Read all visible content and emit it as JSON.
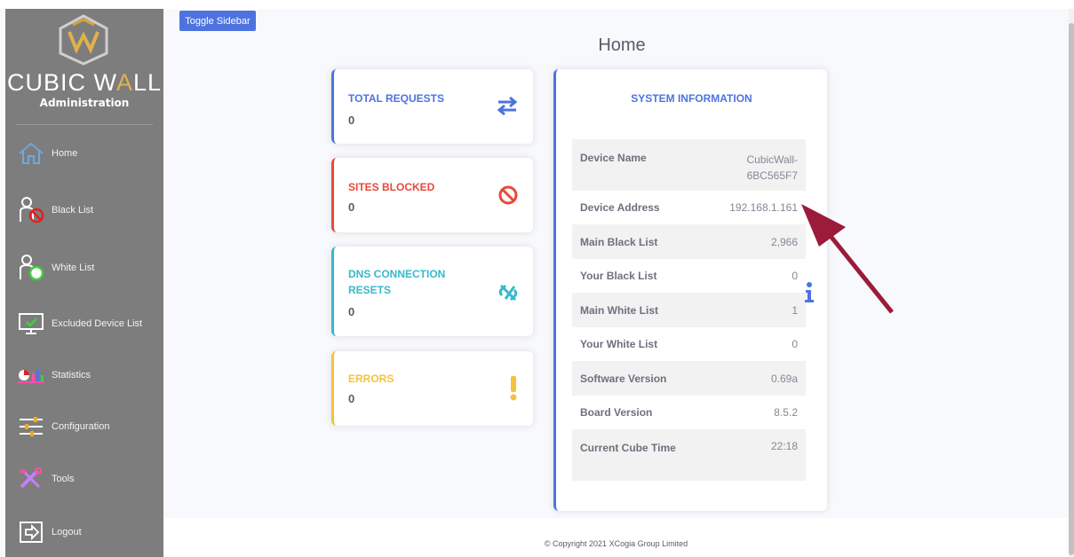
{
  "sidebar": {
    "brand_main": "CUBIC W",
    "brand_accent": "A",
    "brand_tail": "LL",
    "subtitle": "Administration",
    "items": [
      {
        "label": "Home",
        "icon": "home-icon"
      },
      {
        "label": "Black List",
        "icon": "black-list-icon"
      },
      {
        "label": "White List",
        "icon": "white-list-icon"
      },
      {
        "label": "Excluded Device List",
        "icon": "monitor-check-icon"
      },
      {
        "label": "Statistics",
        "icon": "statistics-icon"
      },
      {
        "label": "Configuration",
        "icon": "sliders-icon"
      },
      {
        "label": "Tools",
        "icon": "tools-icon"
      },
      {
        "label": "Logout",
        "icon": "logout-icon"
      }
    ]
  },
  "toggle_sidebar_label": "Toggle Sidebar",
  "page_title": "Home",
  "cards": [
    {
      "title": "TOTAL REQUESTS",
      "value": "0",
      "color": "#4e73df",
      "icon": "arrows-exchange-icon"
    },
    {
      "title": "SITES BLOCKED",
      "value": "0",
      "color": "#e74a3b",
      "icon": "ban-icon"
    },
    {
      "title": "DNS CONNECTION RESETS",
      "value": "0",
      "color": "#36b9cc",
      "icon": "broken-link-icon"
    },
    {
      "title": "ERRORS",
      "value": "0",
      "color": "#f6c23e",
      "icon": "exclamation-icon"
    }
  ],
  "system_info": {
    "title": "SYSTEM INFORMATION",
    "rows": [
      {
        "key": "Device Name",
        "value": "CubicWall-6BC565F7"
      },
      {
        "key": "Device Address",
        "value": "192.168.1.161"
      },
      {
        "key": "Main Black List",
        "value": "2,966"
      },
      {
        "key": "Your Black List",
        "value": "0"
      },
      {
        "key": "Main White List",
        "value": "1"
      },
      {
        "key": "Your White List",
        "value": "0"
      },
      {
        "key": "Software Version",
        "value": "0.69a"
      },
      {
        "key": "Board Version",
        "value": "8.5.2"
      },
      {
        "key": "Current Cube Time",
        "value": "22:18"
      }
    ]
  },
  "footer": "© Copyright 2021 XCogia Group Limited",
  "colors": {
    "primary": "#4e73df",
    "danger": "#e74a3b",
    "info": "#36b9cc",
    "warning": "#f6c23e",
    "annotation_arrow": "#9b1b3a"
  }
}
